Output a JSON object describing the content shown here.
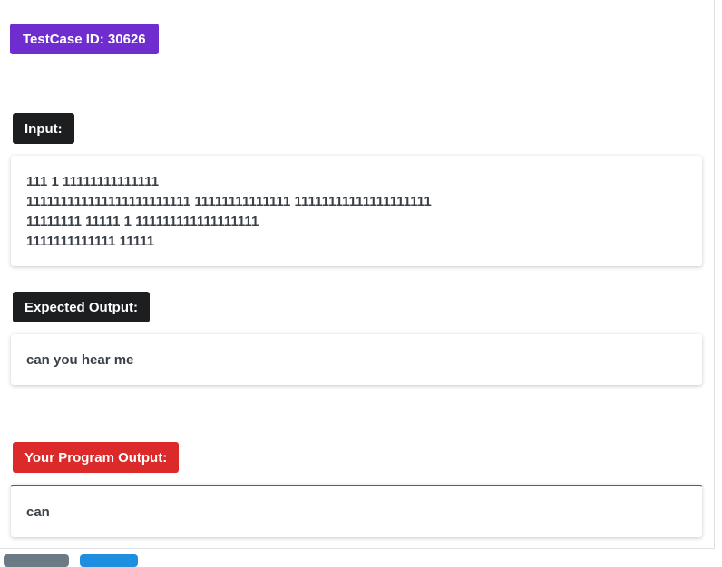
{
  "testcase": {
    "id_label": "TestCase ID: 30626"
  },
  "input": {
    "label": "Input:",
    "lines": [
      "111 1 11111111111111",
      "111111111111111111111111 11111111111111 11111111111111111111",
      "11111111 11111 1 111111111111111111",
      "1111111111111 11111"
    ]
  },
  "expected": {
    "label": "Expected Output:",
    "value": "can you hear me"
  },
  "program": {
    "label": "Your Program Output:",
    "value": "can"
  },
  "colors": {
    "id_badge": "#6f2ccf",
    "dark_badge": "#1d1e20",
    "error_badge": "#dc2a2a",
    "button_secondary": "#6c7a86",
    "button_primary": "#1e8fe0"
  }
}
